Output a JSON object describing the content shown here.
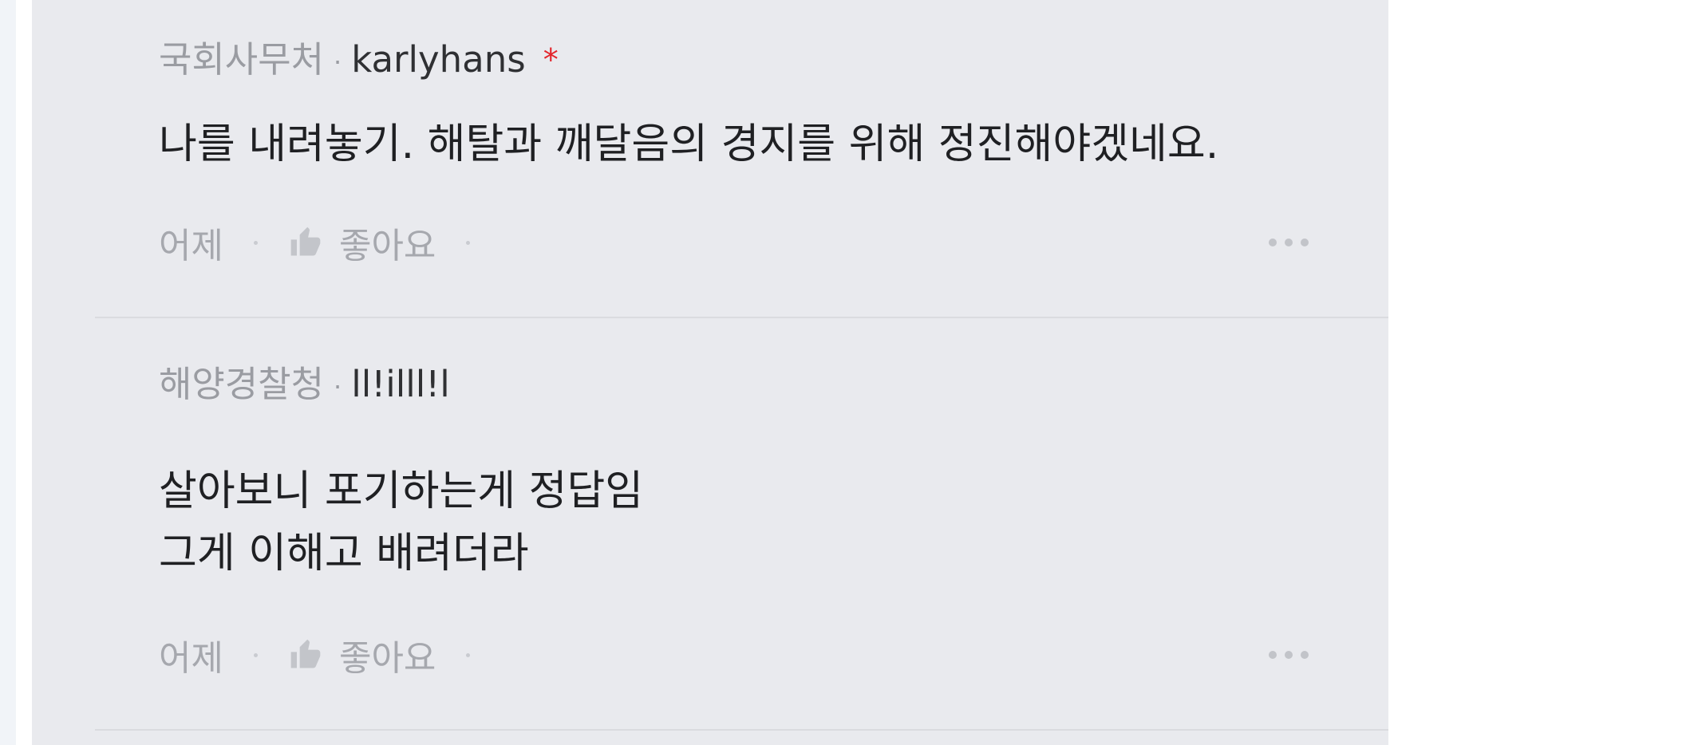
{
  "comments": [
    {
      "affiliation": "국회사무처",
      "separator": "·",
      "username": "karlyhans",
      "badge": "*",
      "lines": [
        "나를 내려놓기. 해탈과 깨달음의 경지를 위해 정진해야겠네요."
      ],
      "time": "어제",
      "like_label": "좋아요"
    },
    {
      "affiliation": "해양경찰청",
      "separator": "·",
      "username": "ll!illl!l",
      "badge": "",
      "lines": [
        "살아보니 포기하는게 정답임",
        "그게 이해고 배려더라"
      ],
      "time": "어제",
      "like_label": "좋아요"
    }
  ],
  "icons": {
    "like": "thumbs-up-icon",
    "more": "more-options-icon"
  },
  "colors": {
    "panel_bg": "#e9eaee",
    "badge": "#e3242b",
    "muted_text": "#9a9ca2",
    "body_text": "#1f2023"
  }
}
